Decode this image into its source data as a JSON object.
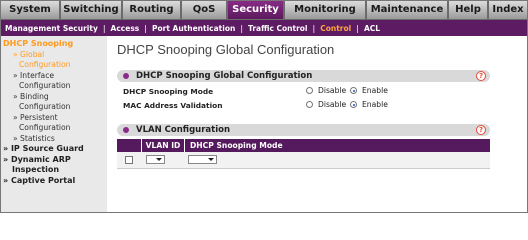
{
  "topnav": [
    "System",
    "Switching",
    "Routing",
    "QoS",
    "Security",
    "Monitoring",
    "Maintenance",
    "Help",
    "Index"
  ],
  "subnav": [
    "Management Security",
    "Access",
    "Port Authentication",
    "Traffic Control",
    "Control",
    "ACL"
  ],
  "sidebar": {
    "section_dhcp": "DHCP Snooping",
    "item_global_1": "» Global",
    "item_global_2": "Configuration",
    "item_interface_1": "» Interface",
    "item_interface_2": "Configuration",
    "item_binding_1": "» Binding",
    "item_binding_2": "Configuration",
    "item_persistent_1": "» Persistent",
    "item_persistent_2": "Configuration",
    "item_statistics": "» Statistics",
    "section_ipsg": "IP Source Guard",
    "section_dai_1": "Dynamic ARP",
    "section_dai_2": "Inspection",
    "section_captive": "Captive Portal"
  },
  "page": {
    "title": "DHCP Snooping Global Configuration",
    "panel1_title": "DHCP Snooping Global Configuration",
    "row1_label": "DHCP Snooping Mode",
    "row2_label": "MAC Address Validation",
    "disable": "Disable",
    "enable": "Enable",
    "mode_value": "Enable",
    "mac_value": "Enable",
    "panel2_title": "VLAN Configuration",
    "col_vlan": "VLAN ID",
    "col_mode": "DHCP Snooping Mode",
    "help": "?"
  }
}
